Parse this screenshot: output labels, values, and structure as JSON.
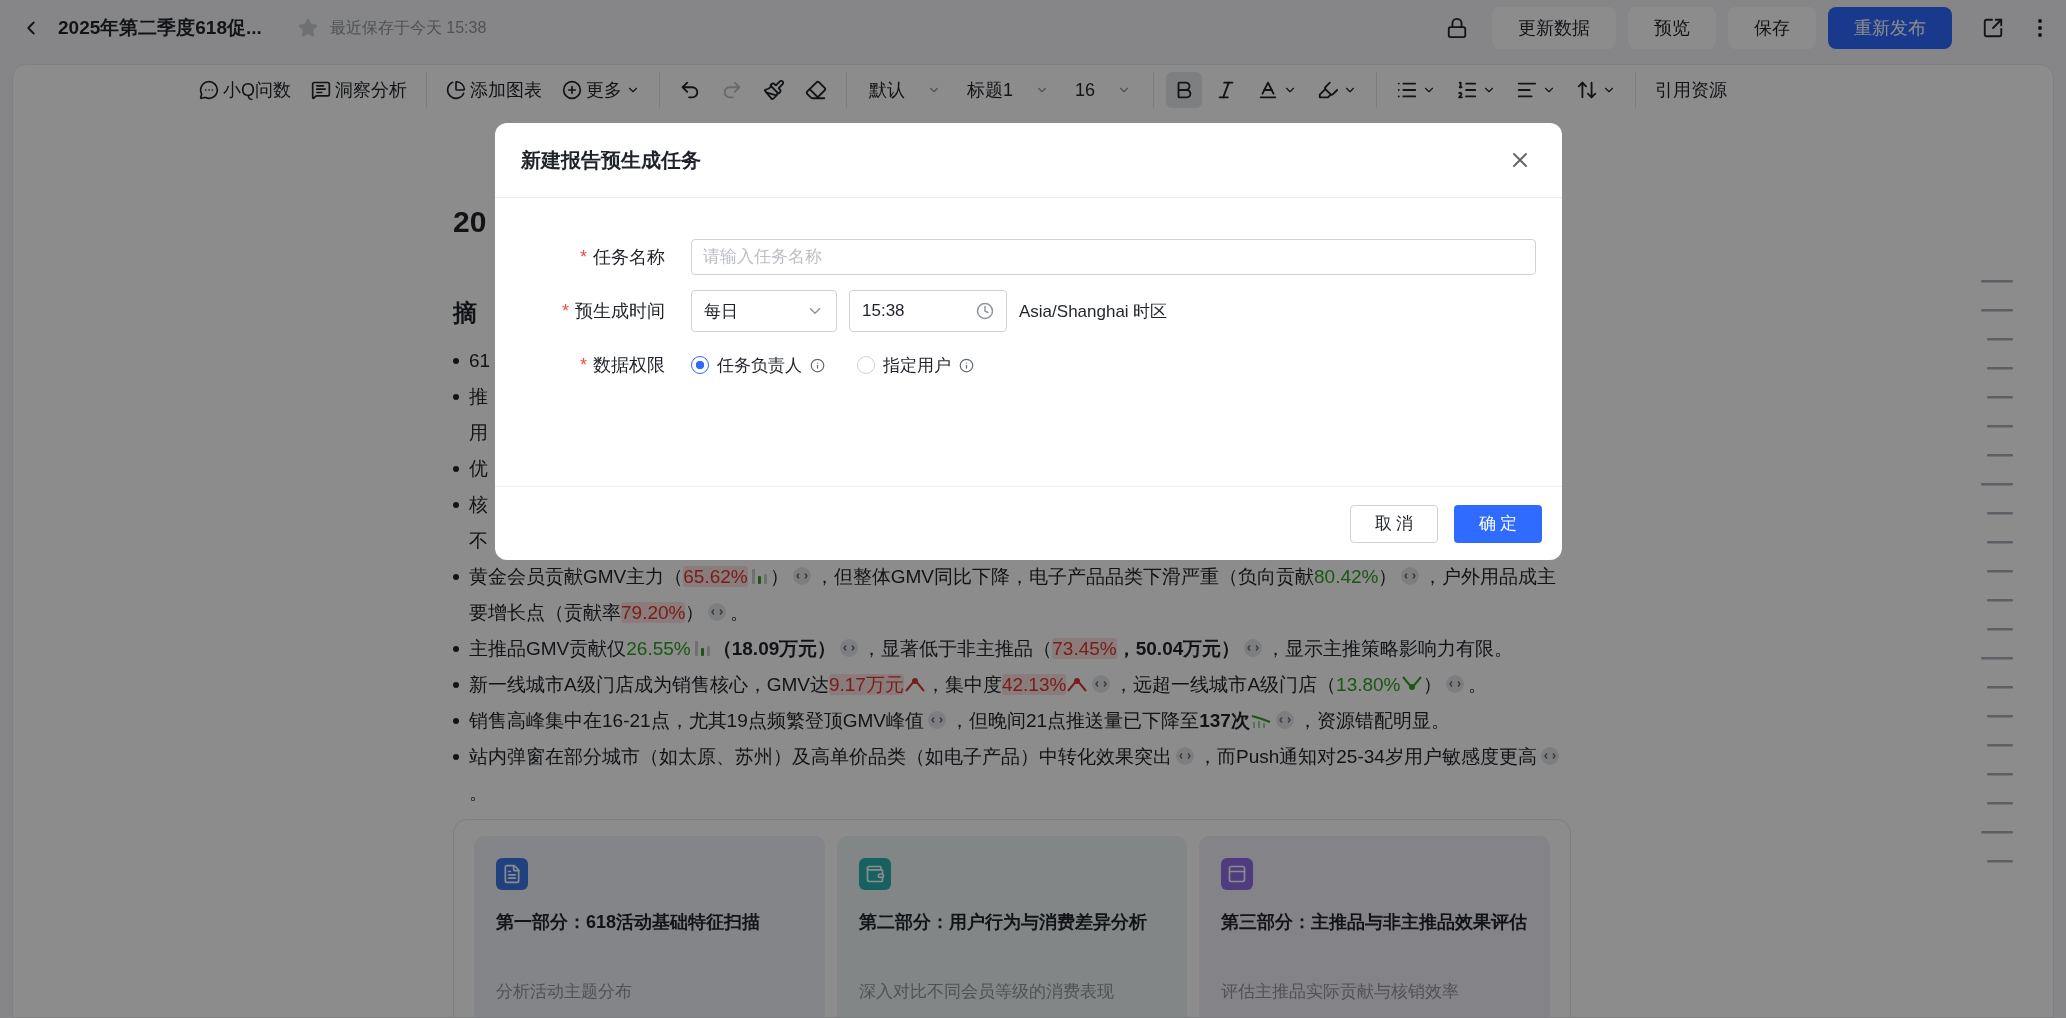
{
  "header": {
    "title": "2025年第二季度618促...",
    "starred": false,
    "save_status": "最近保存于今天 15:38"
  },
  "actions": [
    {
      "label": "更新数据",
      "kind": "secondary"
    },
    {
      "label": "预览",
      "kind": "secondary"
    },
    {
      "label": "保存",
      "kind": "secondary"
    },
    {
      "label": "重新发布",
      "kind": "primary"
    }
  ],
  "toolbar": [
    {
      "items": [
        {
          "kind": "labeled",
          "label": "小Q问数"
        },
        {
          "kind": "labeled",
          "label": "洞察分析"
        }
      ]
    },
    {
      "items": [
        {
          "kind": "labeled",
          "label": "添加图表"
        },
        {
          "kind": "menu",
          "label": "更多"
        }
      ]
    },
    {
      "items": [
        {
          "kind": "icon",
          "disabled": false
        },
        {
          "kind": "icon",
          "disabled": true
        },
        {
          "kind": "icon",
          "disabled": false
        },
        {
          "kind": "icon",
          "disabled": false
        }
      ]
    },
    {
      "items": [
        {
          "kind": "select",
          "label": "默认"
        },
        {
          "kind": "select",
          "label": "标题1"
        },
        {
          "kind": "select",
          "label": "16"
        }
      ]
    },
    {
      "items": [
        {
          "kind": "toggle",
          "selected": true
        },
        {
          "kind": "toggle",
          "selected": false
        },
        {
          "kind": "icon-menu"
        },
        {
          "kind": "icon-menu"
        }
      ]
    },
    {
      "items": [
        {
          "kind": "icon-menu"
        },
        {
          "kind": "icon-menu"
        },
        {
          "kind": "icon-menu"
        },
        {
          "kind": "icon-menu"
        }
      ]
    },
    {
      "items": [
        {
          "kind": "text",
          "label": "引用资源"
        }
      ]
    }
  ],
  "document": {
    "title": "20",
    "heading": "摘",
    "bullets": [
      {
        "kind": "clipped",
        "lines": [
          "61"
        ]
      },
      {
        "kind": "clipped",
        "lines": [
          "推",
          "用"
        ]
      },
      {
        "kind": "clipped",
        "lines": [
          "优"
        ]
      },
      {
        "kind": "clipped",
        "lines": [
          "核",
          "不"
        ]
      },
      {
        "kind": "full",
        "parts": [
          {
            "kind": "text",
            "text": "黄金会员贡献GMV主力（"
          },
          {
            "kind": "up",
            "text": "65.62%"
          },
          {
            "kind": "bars"
          },
          {
            "kind": "text",
            "text": "）"
          },
          {
            "kind": "cite"
          },
          {
            "kind": "text",
            "text": "，但整体GMV同比下降，电子产品品类下滑严重（负向贡献"
          },
          {
            "kind": "down",
            "text": "80.42%"
          },
          {
            "kind": "text",
            "text": "）"
          },
          {
            "kind": "cite"
          },
          {
            "kind": "text",
            "text": "，户外用品成主要增长点（贡献率"
          },
          {
            "kind": "up",
            "text": "79.20%"
          },
          {
            "kind": "text",
            "text": "）"
          },
          {
            "kind": "cite"
          },
          {
            "kind": "text",
            "text": "。"
          }
        ]
      },
      {
        "kind": "full",
        "parts": [
          {
            "kind": "text",
            "text": "主推品GMV贡献仅"
          },
          {
            "kind": "down",
            "text": "26.55%"
          },
          {
            "kind": "bars"
          },
          {
            "kind": "bold",
            "text": "（18.09万元）"
          },
          {
            "kind": "cite"
          },
          {
            "kind": "text",
            "text": "，显著低于非主推品（"
          },
          {
            "kind": "up",
            "text": "73.45%"
          },
          {
            "kind": "bold",
            "text": "，50.04万元）"
          },
          {
            "kind": "cite"
          },
          {
            "kind": "text",
            "text": "，显示主推策略影响力有限。"
          }
        ]
      },
      {
        "kind": "full",
        "parts": [
          {
            "kind": "text",
            "text": "新一线城市A级门店成为销售核心，GMV达"
          },
          {
            "kind": "up",
            "text": "9.17万元"
          },
          {
            "kind": "peak"
          },
          {
            "kind": "text",
            "text": "，集中度"
          },
          {
            "kind": "up",
            "text": "42.13%"
          },
          {
            "kind": "peak"
          },
          {
            "kind": "cite"
          },
          {
            "kind": "text",
            "text": "，远超一线城市A级门店（"
          },
          {
            "kind": "down",
            "text": "13.80%"
          },
          {
            "kind": "dip"
          },
          {
            "kind": "text",
            "text": "）"
          },
          {
            "kind": "cite"
          },
          {
            "kind": "text",
            "text": "。"
          }
        ]
      },
      {
        "kind": "full",
        "parts": [
          {
            "kind": "text",
            "text": "销售高峰集中在16-21点，尤其19点频繁登顶GMV峰值"
          },
          {
            "kind": "cite"
          },
          {
            "kind": "text",
            "text": "，但晚间21点推送量已下降至"
          },
          {
            "kind": "bold",
            "text": "137次"
          },
          {
            "kind": "trend"
          },
          {
            "kind": "cite"
          },
          {
            "kind": "text",
            "text": "，资源错配明显。"
          }
        ]
      },
      {
        "kind": "full",
        "parts": [
          {
            "kind": "text",
            "text": "站内弹窗在部分城市（如太原、苏州）及高单价品类（如电子产品）中转化效果突出"
          },
          {
            "kind": "cite"
          },
          {
            "kind": "text",
            "text": "，而Push通知对25-34岁用户敏感度更高"
          },
          {
            "kind": "cite"
          },
          {
            "kind": "text",
            "text": "。"
          }
        ]
      }
    ],
    "sections": [
      {
        "title": "第一部分：618活动基础特征扫描",
        "subtitle": "分析活动主题分布"
      },
      {
        "title": "第二部分：用户行为与消费差异分析",
        "subtitle": "深入对比不同会员等级的消费表现"
      },
      {
        "title": "第三部分：主推品与非主推品效果评估",
        "subtitle": "评估主推品实际贡献与核销效率"
      }
    ]
  },
  "dialog": {
    "title": "新建报告预生成任务",
    "fields": [
      {
        "kind": "text",
        "label": "任务名称",
        "required_mark": "*",
        "placeholder": "请输入任务名称"
      },
      {
        "kind": "schedule",
        "label": "预生成时间",
        "required_mark": "*",
        "frequency": "每日",
        "time": "15:38",
        "timezone": "Asia/Shanghai 时区"
      },
      {
        "kind": "radio",
        "label": "数据权限",
        "required_mark": "*",
        "options": [
          {
            "label": "任务负责人",
            "selected": true
          },
          {
            "label": "指定用户",
            "selected": false
          }
        ]
      }
    ],
    "buttons": [
      {
        "label": "取 消",
        "kind": "secondary"
      },
      {
        "label": "确 定",
        "kind": "primary"
      }
    ]
  }
}
